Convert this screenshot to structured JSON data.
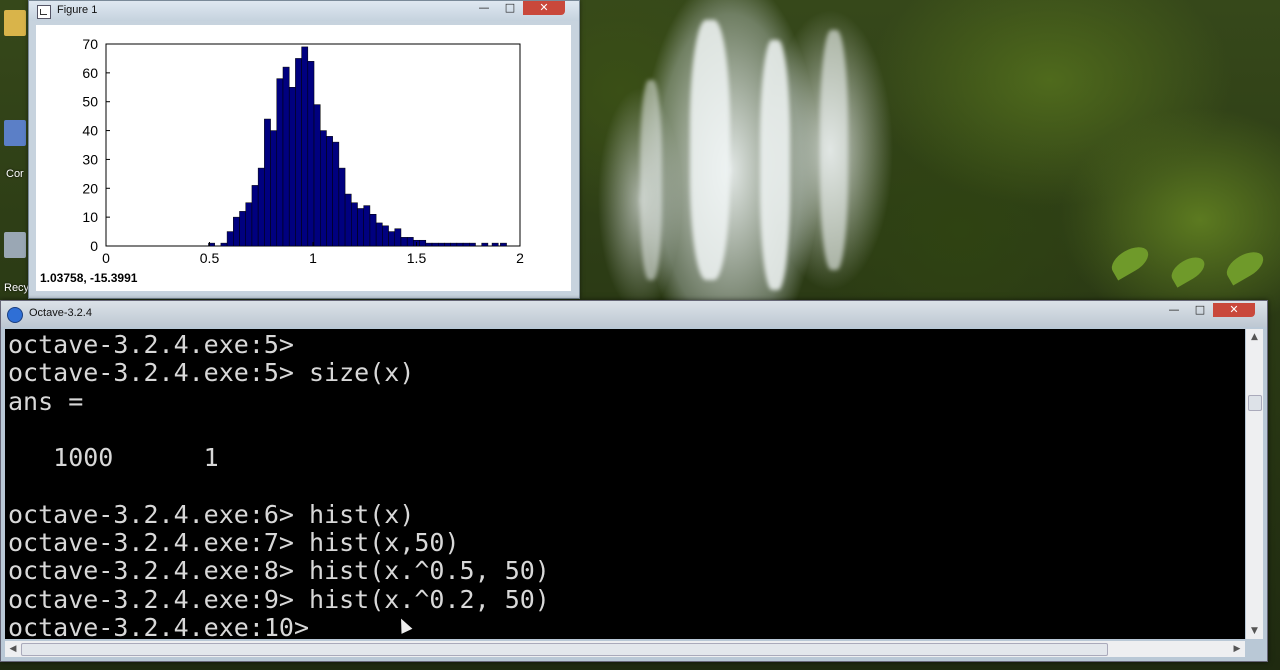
{
  "figure_window": {
    "title": "Figure 1",
    "status_readout": "1.03758, -15.3991"
  },
  "chart_data": {
    "type": "bar",
    "title": "",
    "xlabel": "",
    "ylabel": "",
    "xlim": [
      0,
      2
    ],
    "ylim": [
      0,
      70
    ],
    "x_ticks": [
      "0",
      "0.5",
      "1",
      "1.5",
      "2"
    ],
    "y_ticks": [
      "0",
      "10",
      "20",
      "30",
      "40",
      "50",
      "60",
      "70"
    ],
    "bar_color": "#00007f",
    "bin_centers": [
      0.51,
      0.53,
      0.57,
      0.6,
      0.63,
      0.66,
      0.69,
      0.72,
      0.75,
      0.78,
      0.81,
      0.84,
      0.87,
      0.9,
      0.93,
      0.96,
      0.99,
      1.02,
      1.05,
      1.08,
      1.11,
      1.14,
      1.17,
      1.2,
      1.23,
      1.26,
      1.29,
      1.32,
      1.35,
      1.38,
      1.41,
      1.44,
      1.47,
      1.5,
      1.53,
      1.56,
      1.59,
      1.62,
      1.65,
      1.68,
      1.71,
      1.74,
      1.77,
      1.83,
      1.88,
      1.92
    ],
    "values": [
      1,
      0,
      1,
      5,
      10,
      12,
      15,
      21,
      27,
      44,
      40,
      58,
      62,
      55,
      65,
      69,
      64,
      49,
      40,
      38,
      36,
      27,
      18,
      15,
      13,
      14,
      11,
      8,
      7,
      5,
      6,
      3,
      3,
      2,
      2,
      1,
      1,
      1,
      1,
      1,
      1,
      1,
      1,
      1,
      1,
      1
    ]
  },
  "console_window": {
    "title": "Octave-3.2.4",
    "lines": [
      "octave-3.2.4.exe:5>",
      "octave-3.2.4.exe:5> size(x)",
      "ans =",
      "",
      "   1000      1",
      "",
      "octave-3.2.4.exe:6> hist(x)",
      "octave-3.2.4.exe:7> hist(x,50)",
      "octave-3.2.4.exe:8> hist(x.^0.5, 50)",
      "octave-3.2.4.exe:9> hist(x.^0.2, 50)",
      "octave-3.2.4.exe:10>"
    ]
  },
  "desktop": {
    "icon_labels": [
      "Cor",
      "Recy"
    ]
  }
}
